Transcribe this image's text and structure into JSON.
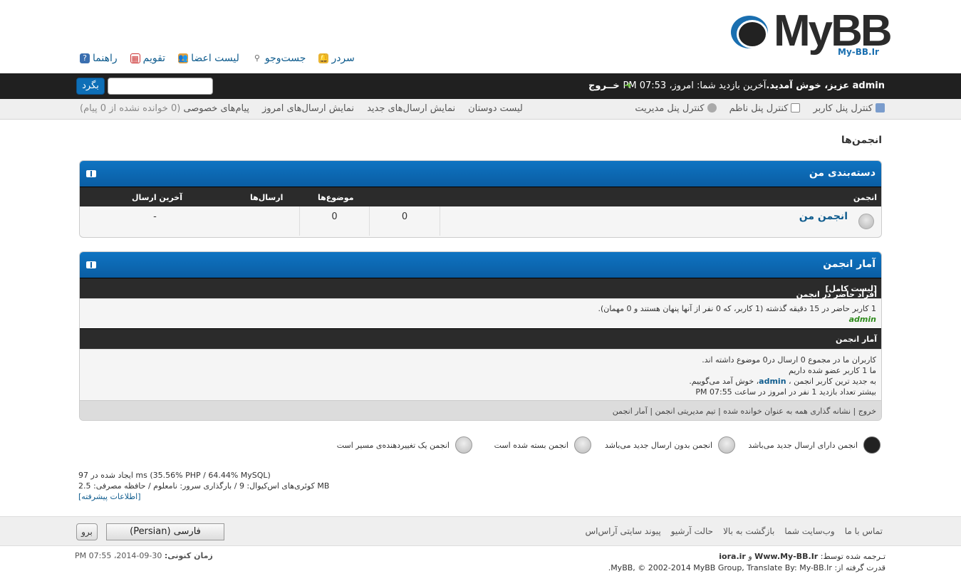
{
  "logo": {
    "text": "MyBB",
    "sub": "My-BB.Ir"
  },
  "topnav": [
    {
      "label": "سردر",
      "icon": "bell-icon"
    },
    {
      "label": "جست‌وجو",
      "icon": "search-icon"
    },
    {
      "label": "لیست اعضا",
      "icon": "members-icon"
    },
    {
      "label": "تقویم",
      "icon": "calendar-icon"
    },
    {
      "label": "راهنما",
      "icon": "help-icon"
    }
  ],
  "welcome": {
    "user": "admin",
    "greeting": " عزیز، خوش آمدید.",
    "last_visit": "آخرین بازدید شما: امروز، 07:53 PM",
    "logout": "خــروج",
    "search_button": "بگرد",
    "search_value": ""
  },
  "userbar": {
    "right": [
      {
        "label": "کنترل پنل کاربر",
        "icon": "user-cp-icon"
      },
      {
        "label": "کنترل پنل ناظم",
        "icon": "mod-cp-icon"
      },
      {
        "label": "کنترل پنل مدیریت",
        "icon": "admin-cp-icon"
      }
    ],
    "left": [
      {
        "label": "لیست دوستان"
      },
      {
        "label": "نمایش ارسال‌های جدید"
      },
      {
        "label": "نمایش ارسال‌های امروز"
      },
      {
        "label": "پیام‌های خصوصی",
        "extra": "(0 خوانده نشده از 0 پیام)"
      }
    ]
  },
  "page_title": "انجمن‌ها",
  "category": {
    "title": "دسته‌بندی من",
    "columns": {
      "forum": "انجمن",
      "threads": "موضوع‌ها",
      "posts": "ارسال‌ها",
      "lastpost": "آخرین ارسال"
    },
    "forum": {
      "name": "انجمن من",
      "threads": "0",
      "posts": "0",
      "lastpost": "-"
    }
  },
  "stats": {
    "title": "آمار انجمن",
    "online_header": "افراد حاضر در انجمن",
    "online_link": "[لیست کامل]",
    "online_text": "1 کاربر حاضر در 15 دقیقه گذشته (1 کاربر، که 0 نفر از آنها پنهان هستند و 0 مهمان).",
    "online_user": "admin",
    "stats_header": "آمار انجمن",
    "line1": "کاربران ما در مجموع 0 ارسال در0 موضوع داشته اند.",
    "line2": "ما 1 کاربر عضو شده داریم",
    "line3_pre": "به جدید ترین کاربر انجمن ،",
    "line3_user": "admin",
    "line3_post": "، خوش آمد می‌گوییم.",
    "line4": "بیشتر تعداد بازدید 1 نفر در امروز در ساعت 07:55 PM",
    "footer_links": "خروج | نشانه گذاری همه به عنوان خوانده شده | تیم مدیریتی انجمن | آمار انجمن"
  },
  "legend": [
    {
      "label": "انجمن دارای ارسال جدید می‌باشد",
      "icon": "forum-new-icon"
    },
    {
      "label": "انجمن بدون ارسال جدید می‌باشد",
      "icon": "forum-old-icon"
    },
    {
      "label": "انجمن بسته شده است",
      "icon": "forum-locked-icon"
    },
    {
      "label": "انجمن یک تغییردهنده‌ی مسیر است",
      "icon": "forum-redirect-icon"
    }
  ],
  "debug": {
    "line1": "ایجاد شده در 97 ms (35.56% PHP / 64.44% MySQL)",
    "line2": "کوئری‌های اس‌کیوال: 9 / بارگذاری سرور: نامعلوم / حافظه مصرفی: 2.5 MB",
    "line3": "[اطلاعات پیشرفته]"
  },
  "footer": {
    "links": [
      "تماس با ما",
      "وب‌سایت شما",
      "بازگشت به بالا",
      "حالت آرشیو",
      "پیوند سایتی آر‌اس‌اس"
    ],
    "language": "فارسی (Persian)",
    "go": "برو",
    "translated_by_label": "تـرجمه شده توسط:",
    "translated_by_1": "Www.My-BB.Ir",
    "translated_and": "و",
    "translated_by_2": "iora.ir",
    "powered_label": "قدرت گرفته از:",
    "powered_text": "MyBB, © 2002-2014 MyBB Group, Translate By: My-BB.Ir.",
    "time_label": "زمان کنونی:",
    "time_value": "30-09-2014، 07:55 PM"
  },
  "colors": {
    "accent": "#0e6fb7",
    "dark_bar": "#202020",
    "link": "#0f5c8e",
    "online_user": "#2c8a1a"
  }
}
